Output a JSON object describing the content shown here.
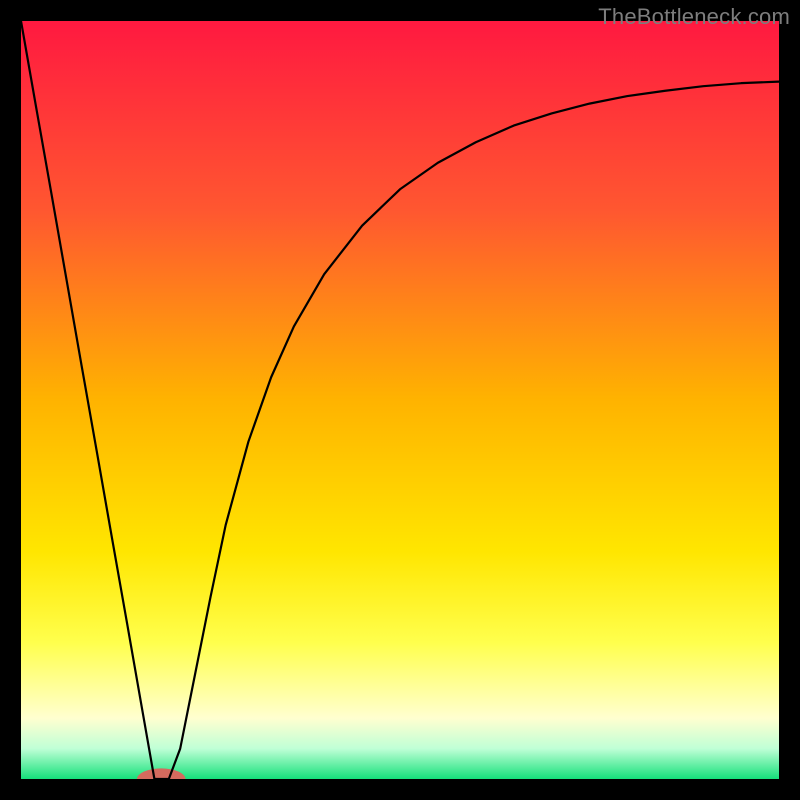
{
  "watermark": "TheBottleneck.com",
  "chart_data": {
    "type": "line",
    "title": "",
    "xlabel": "",
    "ylabel": "",
    "xlim": [
      0,
      100
    ],
    "ylim": [
      0,
      100
    ],
    "series": [
      {
        "name": "curve",
        "x": [
          0,
          2,
          4,
          6,
          8,
          10,
          12,
          14,
          16,
          17.6,
          19.5,
          21,
          23,
          25,
          27,
          30,
          33,
          36,
          40,
          45,
          50,
          55,
          60,
          65,
          70,
          75,
          80,
          85,
          90,
          95,
          100
        ],
        "y": [
          100,
          88.6,
          77.3,
          65.9,
          54.5,
          43.2,
          31.8,
          20.5,
          9.1,
          0,
          0,
          4.0,
          14.0,
          24.0,
          33.5,
          44.5,
          53.0,
          59.7,
          66.6,
          73.0,
          77.8,
          81.3,
          84.0,
          86.2,
          87.8,
          89.1,
          90.1,
          90.8,
          91.4,
          91.8,
          92.0
        ]
      }
    ],
    "gradient_stops": [
      {
        "pct": 0,
        "color": "#ff1940"
      },
      {
        "pct": 25,
        "color": "#ff5730"
      },
      {
        "pct": 50,
        "color": "#ffb300"
      },
      {
        "pct": 70,
        "color": "#ffe600"
      },
      {
        "pct": 82,
        "color": "#ffff4d"
      },
      {
        "pct": 92,
        "color": "#ffffd0"
      },
      {
        "pct": 96,
        "color": "#bfffd6"
      },
      {
        "pct": 100,
        "color": "#15e07a"
      }
    ],
    "marker": {
      "x": 18.5,
      "y": 0,
      "rx": 3.2,
      "ry": 1.4,
      "color": "#d46a5e"
    }
  }
}
